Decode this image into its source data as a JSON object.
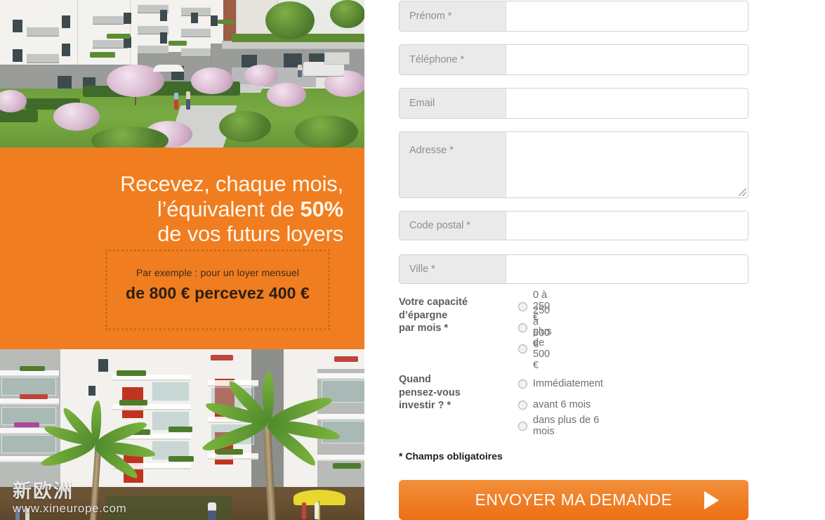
{
  "promo": {
    "headline_line1": "Recevez, chaque mois,",
    "headline_line2_pre": "l’équivalent de ",
    "headline_line2_bold": "50%",
    "headline_line3": "de vos futurs loyers",
    "example_line1": "Par exemple : pour un loyer mensuel",
    "example_line2": "de  800 € percevez 400 €",
    "orange": "#f07d1f",
    "dotted_border": "#d46a12",
    "headline_color": "#fdf6ec"
  },
  "watermark": {
    "brand_cn": "新欧洲",
    "url": "www.xineurope.com"
  },
  "form": {
    "fields": [
      {
        "name": "prenom",
        "label": "Prénom *",
        "value": "",
        "type": "text"
      },
      {
        "name": "telephone",
        "label": "Téléphone *",
        "value": "",
        "type": "text"
      },
      {
        "name": "email",
        "label": "Email",
        "value": "",
        "type": "text"
      },
      {
        "name": "adresse",
        "label": "Adresse *",
        "value": "",
        "type": "textarea"
      },
      {
        "name": "code-postal",
        "label": "Code postal *",
        "value": "",
        "type": "text"
      },
      {
        "name": "ville",
        "label": "Ville *",
        "value": "",
        "type": "text"
      }
    ],
    "radio_groups": [
      {
        "name": "capacite-epargne",
        "label": "Votre capacité d’épargne par mois *",
        "label_lines": [
          "Votre capacité",
          "d’épargne",
          "par mois *"
        ],
        "options": [
          "0 à 250 €",
          "250 à 500 €",
          "plus de 500 €"
        ],
        "selected": null
      },
      {
        "name": "quand-investir",
        "label": "Quand pensez-vous investir ? *",
        "label_lines": [
          "Quand",
          "pensez-vous",
          "investir ? *"
        ],
        "options": [
          "Immédiatement",
          "avant 6 mois",
          "dans plus de 6 mois"
        ],
        "selected": null
      }
    ],
    "required_note": "* Champs obligatoires",
    "submit_label": "ENVOYER MA DEMANDE",
    "submit_icon": "play-arrow-icon",
    "submit_color": "#ed6f15"
  }
}
